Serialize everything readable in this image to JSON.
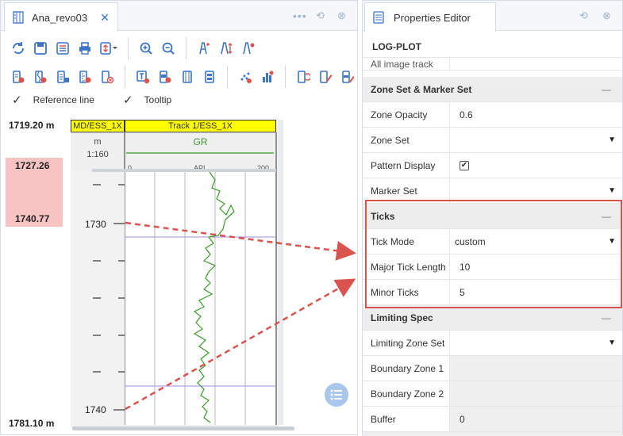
{
  "left_panel": {
    "tab_label": "Ana_revo03",
    "options": {
      "reference_line": "Reference line",
      "tooltip": "Tooltip"
    },
    "depth": {
      "top": "1719.20 m",
      "bottom": "1781.10 m",
      "range_start": "1727.26",
      "range_end": "1740.77"
    },
    "md_track": {
      "header": "MD/ESS_1X",
      "unit": "m",
      "scale": "1:160",
      "ticks": [
        "1730",
        "1740"
      ]
    },
    "track1": {
      "header": "Track 1/ESS_1X",
      "curve": "GR",
      "axis_min": "0",
      "axis_unit": "API",
      "axis_max": "200"
    }
  },
  "right_panel": {
    "tab_label": "Properties Editor",
    "object_title": "LOG-PLOT",
    "partial_row": "All image track",
    "sections": {
      "zone_marker": {
        "title": "Zone Set & Marker Set",
        "zone_opacity": {
          "label": "Zone Opacity",
          "value": "0.6"
        },
        "zone_set": {
          "label": "Zone Set",
          "value": ""
        },
        "pattern_display": {
          "label": "Pattern Display",
          "checked": true
        },
        "marker_set": {
          "label": "Marker Set",
          "value": ""
        }
      },
      "ticks": {
        "title": "Ticks",
        "tick_mode": {
          "label": "Tick Mode",
          "value": "custom"
        },
        "major_tick_length": {
          "label": "Major Tick Length",
          "value": "10"
        },
        "minor_ticks": {
          "label": "Minor Ticks",
          "value": "5"
        }
      },
      "limiting_spec": {
        "title": "Limiting Spec",
        "limiting_zone_set": {
          "label": "Limiting Zone Set",
          "value": ""
        },
        "boundary_zone_1": {
          "label": "Boundary Zone 1",
          "value": ""
        },
        "boundary_zone_2": {
          "label": "Boundary Zone 2",
          "value": ""
        },
        "buffer": {
          "label": "Buffer",
          "value": "0"
        }
      }
    }
  },
  "colors": {
    "accent": "#3d74c6",
    "header_yellow": "#ffff00",
    "highlight_band": "#f7c3c3",
    "curve": "#3a9a2a",
    "annotation_red": "#d9534f",
    "marker_line": "#9b8fe0"
  }
}
